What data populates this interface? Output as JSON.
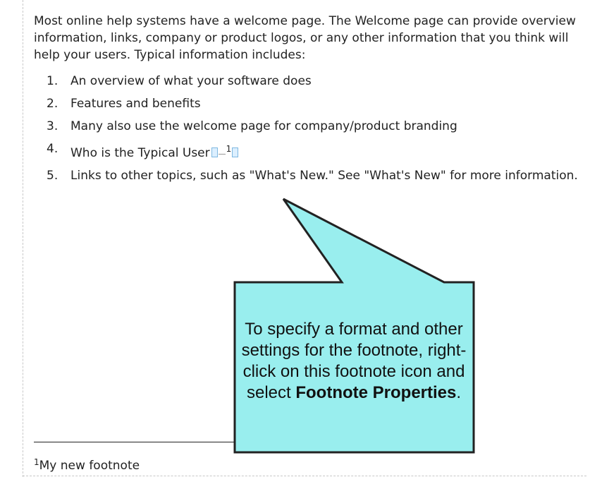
{
  "document": {
    "intro": "Most online help systems have a welcome page. The Welcome page can provide overview information, links, company or product logos, or any other information that you think will help your users. Typical information includes:",
    "list": [
      {
        "num": "1.",
        "text": "An overview of what your software does"
      },
      {
        "num": "2.",
        "text": "Features and benefits"
      },
      {
        "num": "3.",
        "text": "Many also use the welcome page for company/product branding"
      },
      {
        "num": "4.",
        "text": "Who is the Typical User",
        "footnote_ref": "1"
      },
      {
        "num": "5.",
        "text": "Links to other topics, such as \"What's New.\" See \"What's New\" for more information."
      }
    ]
  },
  "footnote": {
    "number": "1",
    "text": "My new footnote"
  },
  "callout": {
    "text_before": "To specify a format and other settings for the footnote, right-click on this footnote icon and select ",
    "text_bold": "Footnote Properties",
    "text_after": ".",
    "fill_color": "#99eeee",
    "border_color": "#222222"
  }
}
